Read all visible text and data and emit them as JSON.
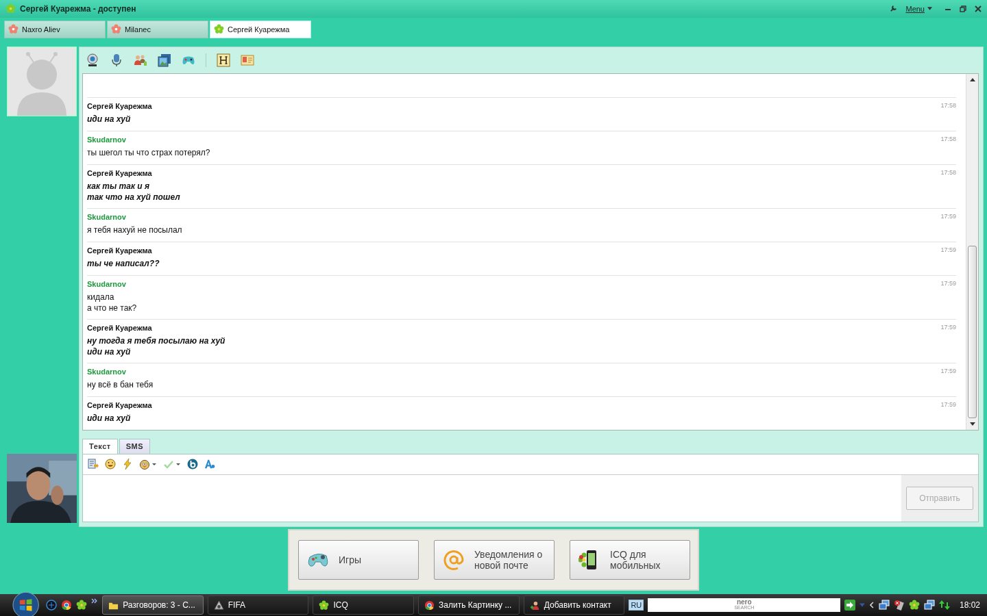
{
  "window": {
    "title": "Сергей Куарежма - доступен",
    "menu": "Menu"
  },
  "tabs": [
    {
      "label": "Naxro Aliev",
      "selected": false,
      "online": false
    },
    {
      "label": "Milanec",
      "selected": false,
      "online": false
    },
    {
      "label": "Сергей Куарежма",
      "selected": true,
      "online": true
    }
  ],
  "messages": [
    {
      "kind": "outgoing",
      "sender": "Сергей Куарежма",
      "time": "17:58",
      "lines": [
        "иди на хуй"
      ]
    },
    {
      "kind": "incoming",
      "sender": "Skudarnov",
      "time": "17:58",
      "lines": [
        "ты шегол ты что страх потерял?"
      ]
    },
    {
      "kind": "outgoing",
      "sender": "Сергей Куарежма",
      "time": "17:58",
      "lines": [
        "как ты так и я",
        "так что на хуй пошел"
      ]
    },
    {
      "kind": "incoming",
      "sender": "Skudarnov",
      "time": "17:59",
      "lines": [
        "я тебя нахуй не посылал"
      ]
    },
    {
      "kind": "outgoing",
      "sender": "Сергей Куарежма",
      "time": "17:59",
      "lines": [
        "ты че написал??"
      ]
    },
    {
      "kind": "incoming",
      "sender": "Skudarnov",
      "time": "17:59",
      "lines": [
        "кидала",
        "а что не так?"
      ]
    },
    {
      "kind": "outgoing",
      "sender": "Сергей Куарежма",
      "time": "17:59",
      "lines": [
        "ну тогда я тебя посылаю на хуй",
        "иди на хуй"
      ]
    },
    {
      "kind": "incoming",
      "sender": "Skudarnov",
      "time": "17:59",
      "lines": [
        "ну всё в бан тебя"
      ]
    },
    {
      "kind": "outgoing",
      "sender": "Сергей Куарежма",
      "time": "17:59",
      "lines": [
        "иди на хуй"
      ]
    }
  ],
  "input_tabs": [
    {
      "label": "Текст",
      "selected": true
    },
    {
      "label": "SMS",
      "selected": false
    }
  ],
  "send_button": {
    "label": "Отправить",
    "disabled": true
  },
  "promos": [
    {
      "kind": "games",
      "label": "Игры"
    },
    {
      "kind": "mail",
      "label": "Уведомления о новой почте"
    },
    {
      "kind": "mobile",
      "label": "ICQ для мобильных"
    }
  ],
  "taskbar": {
    "items": [
      {
        "kind": "folder",
        "label": "Разговоров: 3 - С...",
        "selected": true
      },
      {
        "kind": "fifa",
        "label": "FIFA",
        "selected": false
      },
      {
        "kind": "icq",
        "label": "ICQ",
        "selected": false
      },
      {
        "kind": "chrome",
        "label": "Залить Картинку ...",
        "selected": false
      },
      {
        "kind": "contact",
        "label": "Добавить контакт",
        "selected": false
      }
    ],
    "language": "RU",
    "search_logo": [
      "nero",
      "SEARCH"
    ],
    "clock": "18:02"
  }
}
